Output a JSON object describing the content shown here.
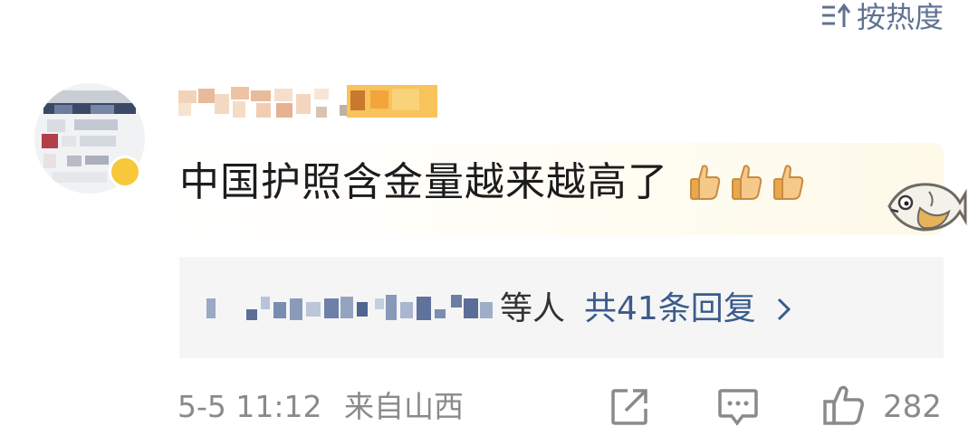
{
  "sort": {
    "label": "按热度",
    "icon": "sort-icon"
  },
  "comment": {
    "text": "中国护照含金量越来越高了",
    "emoji": [
      "thumbs-up",
      "thumbs-up",
      "thumbs-up"
    ],
    "avatar_badge_color": "#f6c83a"
  },
  "replies": {
    "author_suffix": "等人",
    "count_label": "共41条回复"
  },
  "footer": {
    "date": "5-5 11:12",
    "source": "来自山西",
    "likes": "282"
  },
  "colors": {
    "link": "#3b5b8c",
    "meta": "#8a8a8a",
    "reply_bg": "#f5f5f5"
  }
}
